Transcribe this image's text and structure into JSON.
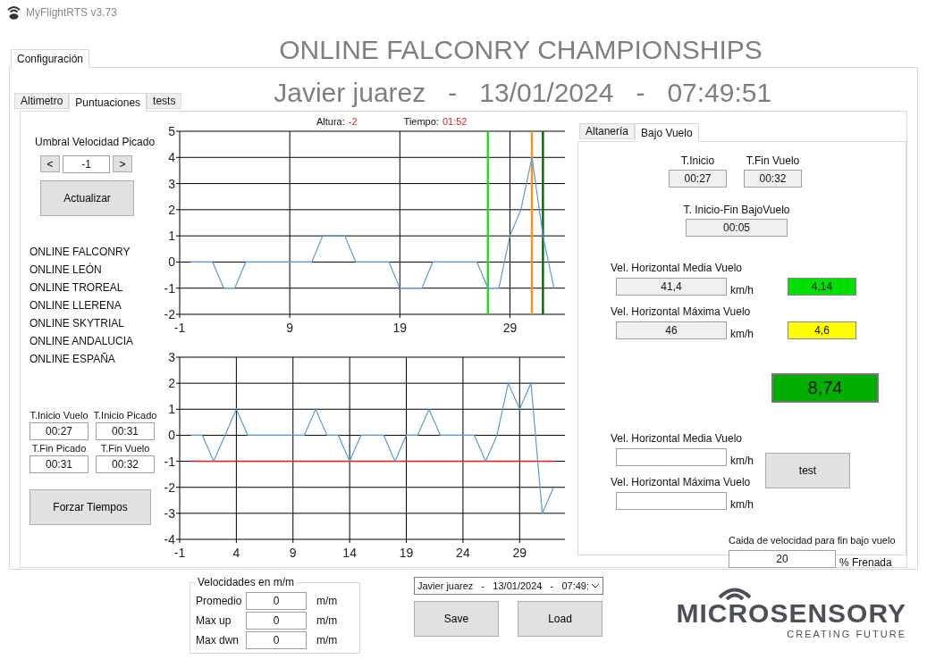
{
  "app": {
    "title": "MyFlightRTS v3.73"
  },
  "header": {
    "title": "ONLINE FALCONRY CHAMPIONSHIPS",
    "subtitle": "Javier juarez   -   13/01/2024   -   07:49:51"
  },
  "main_tabs": [
    {
      "label": "Configuración",
      "selected": true
    }
  ],
  "sub_tabs": [
    {
      "label": "Altimetro",
      "selected": false
    },
    {
      "label": "Puntuaciones",
      "selected": true
    },
    {
      "label": "tests",
      "selected": false
    }
  ],
  "left_panel": {
    "threshold_label": "Umbral Velocidad Picado",
    "decrement": "<",
    "threshold_value": "-1",
    "increment": ">",
    "update_button": "Actualizar",
    "competitions": [
      "ONLINE FALCONRY",
      "ONLINE LEÓN",
      "ONLINE TROREAL",
      "ONLINE LLERENA",
      "ONLINE SKYTRIAL",
      "ONLINE ANDALUCIA",
      "ONLINE ESPAÑA"
    ],
    "times": [
      {
        "label": "T.Inicio Vuelo",
        "value": "00:27"
      },
      {
        "label": "T.Inicio Picado",
        "value": "00:31"
      },
      {
        "label": "T.Fin Picado",
        "value": "00:31"
      },
      {
        "label": "T.Fin Vuelo",
        "value": "00:32"
      }
    ],
    "force_button": "Forzar Tiempos"
  },
  "altitude_chart": {
    "altura_label": "Altura:",
    "altura_value": "-2",
    "tiempo_label": "Tiempo:",
    "tiempo_value": "01:52",
    "chart_data": {
      "type": "line",
      "x": [
        0,
        1,
        2,
        3,
        4,
        5,
        6,
        7,
        8,
        9,
        10,
        11,
        12,
        13,
        14,
        15,
        16,
        17,
        18,
        19,
        20,
        21,
        22,
        23,
        24,
        25,
        26,
        27,
        28,
        29,
        30,
        31,
        32,
        33
      ],
      "series": [
        {
          "color": "#5b9bd5",
          "values": [
            0,
            0,
            0,
            -1,
            -1,
            0,
            0,
            0,
            0,
            0,
            0,
            0,
            1,
            1,
            1,
            0,
            0,
            0,
            0,
            -1,
            -1,
            -1,
            0,
            0,
            0,
            0,
            0,
            -1,
            -1,
            1,
            2,
            4,
            1,
            -1
          ]
        }
      ],
      "xlim": [
        -1,
        34
      ],
      "ylim": [
        -2,
        5
      ],
      "xticks": [
        -1,
        9,
        19,
        29
      ],
      "yticks": [
        -2,
        -1,
        0,
        1,
        2,
        3,
        4,
        5
      ],
      "grid": true,
      "ref_lines": [
        {
          "axis": "x",
          "value": 27,
          "color": "#22dd22"
        },
        {
          "axis": "x",
          "value": 31,
          "color": "#f7941d"
        },
        {
          "axis": "x",
          "value": 32,
          "color": "#116611"
        }
      ]
    }
  },
  "speed_chart": {
    "chart_data": {
      "type": "line",
      "x": [
        0,
        1,
        2,
        3,
        4,
        5,
        6,
        7,
        8,
        9,
        10,
        11,
        12,
        13,
        14,
        15,
        16,
        17,
        18,
        19,
        20,
        21,
        22,
        23,
        24,
        25,
        26,
        27,
        28,
        29,
        30,
        31,
        32
      ],
      "series": [
        {
          "color": "#5b9bd5",
          "values": [
            0,
            0,
            -1,
            0,
            1,
            0,
            0,
            0,
            0,
            0,
            0,
            1,
            0,
            0,
            -1,
            0,
            0,
            0,
            -1,
            0,
            0,
            1,
            0,
            0,
            0,
            0,
            -1,
            0,
            2,
            1,
            2,
            -3,
            -2
          ]
        }
      ],
      "xlim": [
        -1,
        33
      ],
      "ylim": [
        -4,
        3
      ],
      "xticks": [
        -1,
        4,
        9,
        14,
        19,
        24,
        29
      ],
      "yticks": [
        -4,
        -3,
        -2,
        -1,
        0,
        1,
        2,
        3
      ],
      "grid": true,
      "ref_lines": [
        {
          "axis": "y",
          "value": -1,
          "color": "#e02020"
        }
      ]
    }
  },
  "right_tabs": [
    {
      "label": "Altanería",
      "selected": false
    },
    {
      "label": "Bajo Vuelo",
      "selected": true
    }
  ],
  "bajo_vuelo": {
    "times": [
      {
        "label": "T.Inicio",
        "value": "00:27"
      },
      {
        "label": "T.Fin Vuelo",
        "value": "00:32"
      }
    ],
    "duration": {
      "label": "T. Inicio-Fin BajoVuelo",
      "value": "00:05"
    },
    "speeds": [
      {
        "label": "Vel. Horizontal Media Vuelo",
        "value": "41,4",
        "unit": "km/h",
        "score": "4,14",
        "color": "#00e000"
      },
      {
        "label": "Vel. Horizontal Máxima Vuelo",
        "value": "46",
        "unit": "km/h",
        "score": "4,6",
        "color": "#ffff00"
      }
    ],
    "total": {
      "value": "8,74",
      "color": "#00b000"
    },
    "test_inputs": [
      {
        "label": "Vel. Horizontal Media Vuelo",
        "unit": "km/h"
      },
      {
        "label": "Vel. Horizontal Máxima Vuelo",
        "unit": "km/h"
      }
    ],
    "test_button": "test",
    "drop": {
      "label": "Caida de velocidad para fin bajo vuelo",
      "value": "20",
      "unit": "% Frenada"
    }
  },
  "velocidades": {
    "title": "Velocidades en m/m",
    "rows": [
      {
        "label": "Promedio",
        "value": "0",
        "unit": "m/m"
      },
      {
        "label": "Max up",
        "value": "0",
        "unit": "m/m"
      },
      {
        "label": "Max dwn",
        "value": "0",
        "unit": "m/m"
      }
    ]
  },
  "session_select": {
    "value": "Javier juarez   -   13/01/2024   -   07:49:"
  },
  "buttons": [
    "Save",
    "Load"
  ],
  "logo": {
    "name": "MICROSENSORY",
    "tagline": "CREATING FUTURE"
  }
}
